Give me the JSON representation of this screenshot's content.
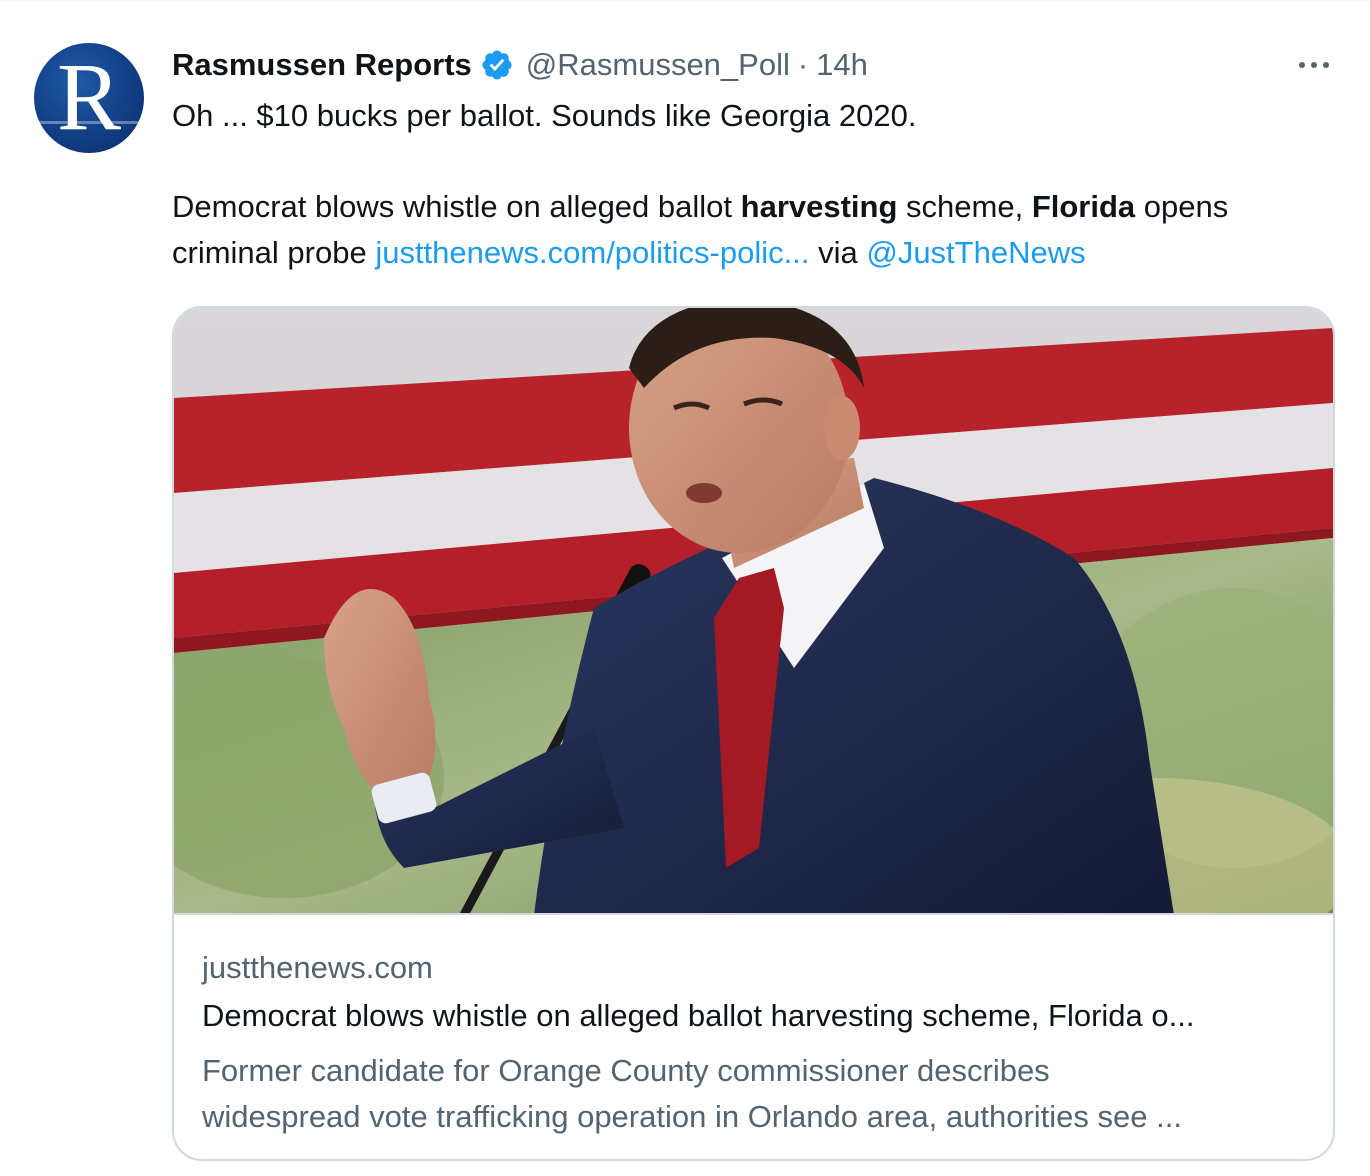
{
  "tweet": {
    "author_name": "Rasmussen Reports",
    "author_handle": "@Rasmussen_Poll",
    "separator": "·",
    "time": "14h",
    "avatar_letter": "R",
    "text_line1": "Oh ... $10 bucks per ballot. Sounds like Georgia 2020.",
    "line2_part1": "Democrat blows whistle on alleged ballot ",
    "line2_bold1": "harvesting",
    "line2_part2": " scheme, ",
    "line2_bold2": "Florida",
    "line2_part3": " opens",
    "line3_part1": "criminal probe ",
    "link_url_text": "justthenews.com/politics-polic...",
    "line3_via": " via ",
    "mention": "@JustTheNews"
  },
  "card": {
    "domain": "justthenews.com",
    "title": "Democrat blows whistle on alleged ballot harvesting scheme, Florida o...",
    "desc_line1": "Former candidate for Orange County commissioner describes",
    "desc_line2": "widespread vote trafficking operation in Orlando area, authorities see ..."
  },
  "colors": {
    "link": "#1d9bf0",
    "secondary_text": "#536471",
    "verified_badge": "#1d9bf0",
    "avatar_bg": "#123f86"
  },
  "icons": {
    "verified": "verified-badge-icon",
    "more": "more-options-icon"
  }
}
